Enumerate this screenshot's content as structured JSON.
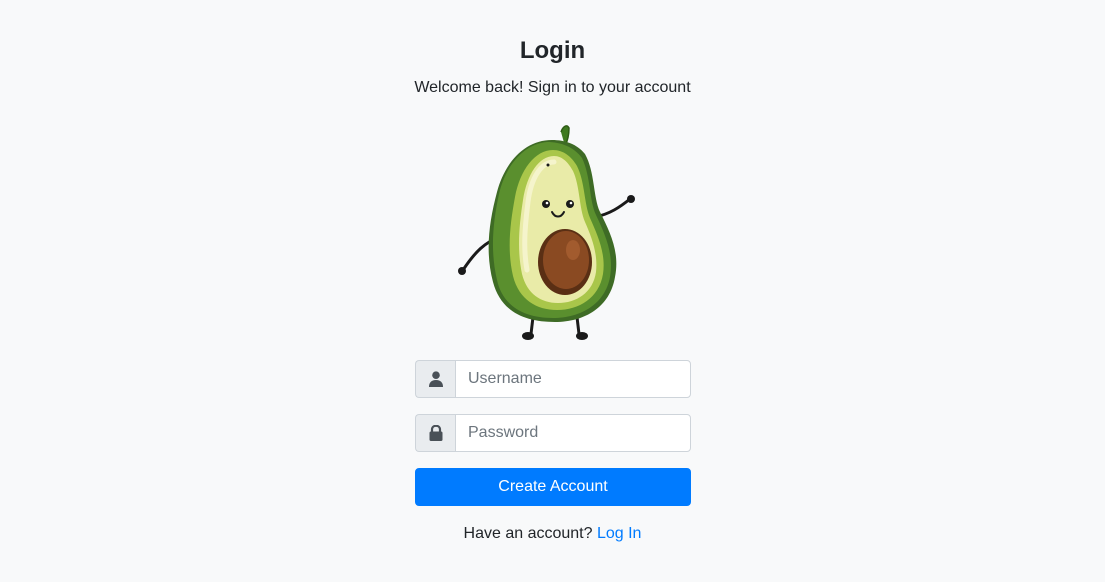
{
  "page": {
    "title": "Login",
    "subtitle": "Welcome back! Sign in to your account"
  },
  "mascot": {
    "icon": "avocado-mascot-icon"
  },
  "form": {
    "username": {
      "placeholder": "Username",
      "value": "",
      "icon": "user-icon"
    },
    "password": {
      "placeholder": "Password",
      "value": "",
      "icon": "lock-icon"
    },
    "submit_label": "Create Account"
  },
  "footer": {
    "prompt": "Have an account?",
    "link_label": "Log In"
  },
  "colors": {
    "background": "#f8f9fa",
    "primary": "#007bff",
    "text": "#212529",
    "addon_bg": "#e9ecef",
    "border": "#ced4da"
  }
}
